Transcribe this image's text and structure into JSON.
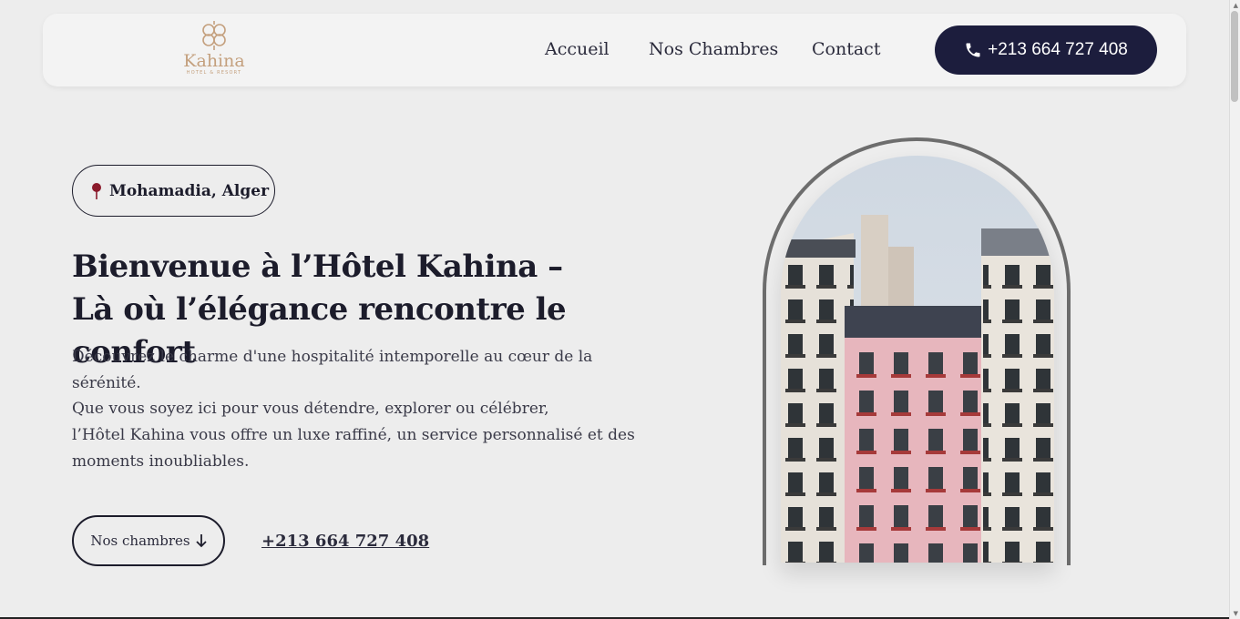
{
  "brand": {
    "name": "Kahina",
    "subtitle": "HOTEL & RESORT",
    "accent_color": "#c4a07e"
  },
  "nav": {
    "items": [
      {
        "label": "Accueil"
      },
      {
        "label": "Nos Chambres"
      },
      {
        "label": "Contact"
      }
    ],
    "phone_button": {
      "label": "+213 664 727 408",
      "icon": "phone-icon",
      "bg_color": "#1c1d3d"
    }
  },
  "hero": {
    "location": {
      "label": "Mohamadia, Alger",
      "icon": "map-pin-icon"
    },
    "title_line1": "Bienvenue à l’Hôtel Kahina –",
    "title_line2": "Là où l’élégance rencontre le confort",
    "description_line1": "Découvrez le charme d'une hospitalité intemporelle au cœur de la sérénité.",
    "description_line2": "Que vous soyez ici pour vous détendre, explorer ou célébrer,",
    "description_line3": "l’Hôtel Kahina vous offre un luxe raffiné, un service personnalisé et des moments inoubliables.",
    "rooms_button": {
      "label": "Nos chambres",
      "icon": "arrow-down-icon"
    },
    "phone_link": "+213 664 727 408",
    "image": {
      "icon": "hotel-building-image"
    }
  }
}
